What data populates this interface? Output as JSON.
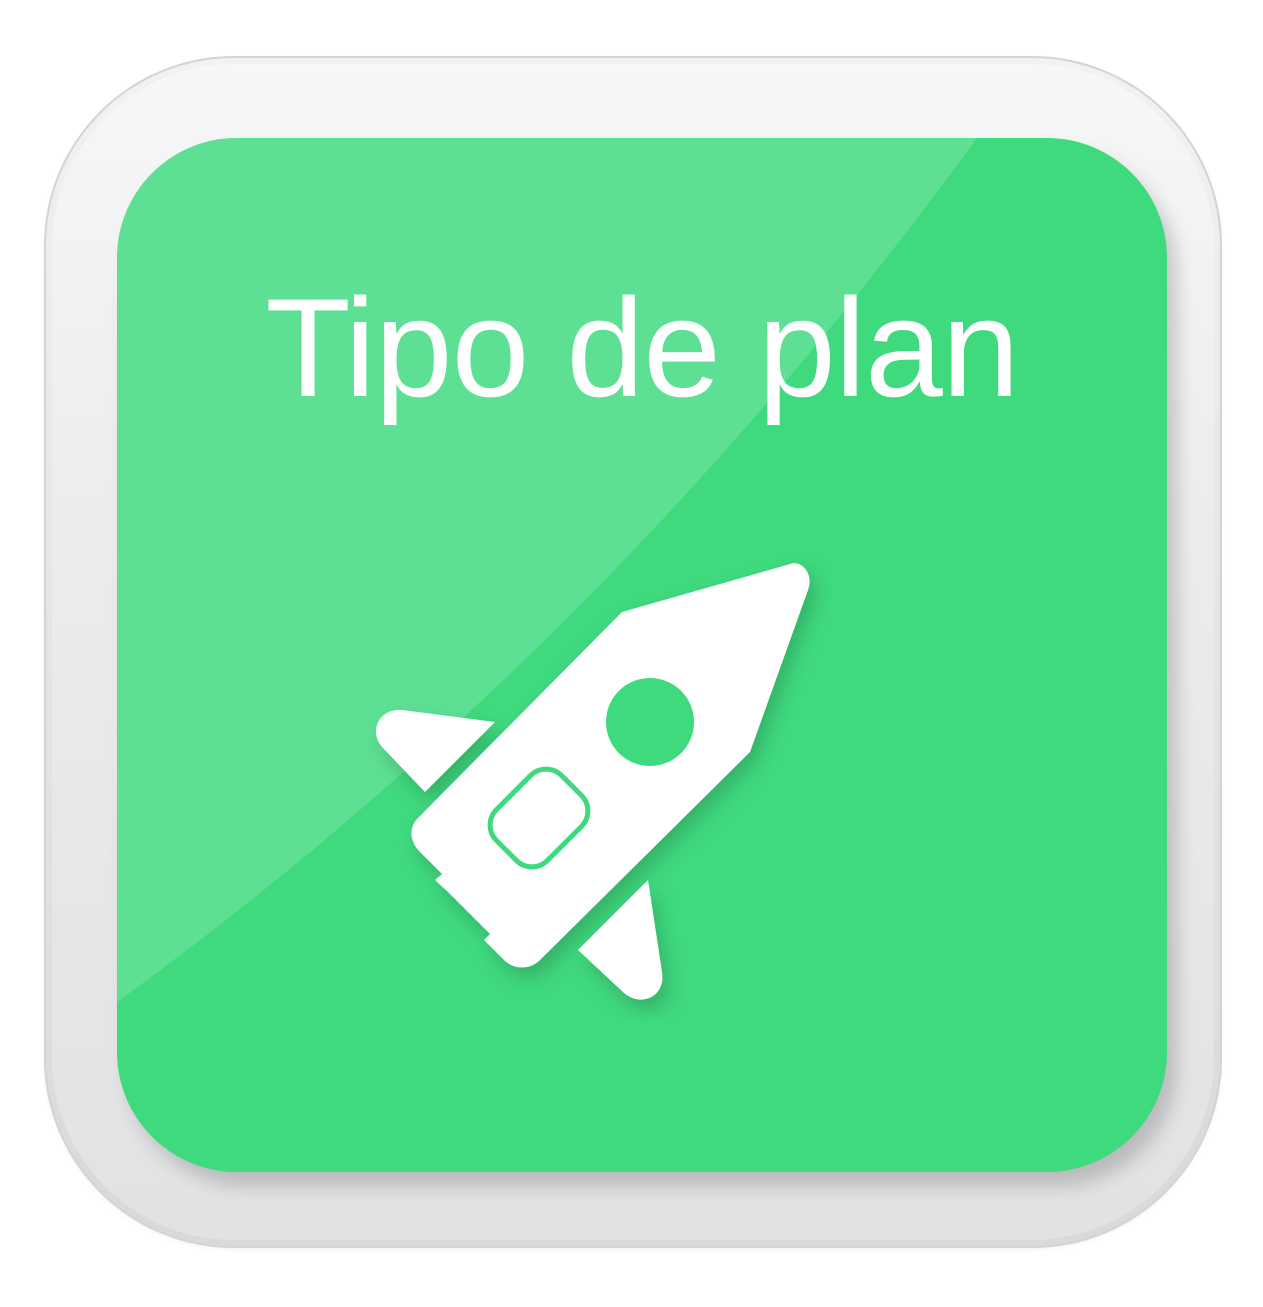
{
  "button": {
    "title": "Tipo de plan",
    "icon": "rocket-icon",
    "colors": {
      "face": "#3fd97e",
      "highlight": "#5de093",
      "bezel": "#e4e5e7",
      "text": "#ffffff"
    }
  }
}
